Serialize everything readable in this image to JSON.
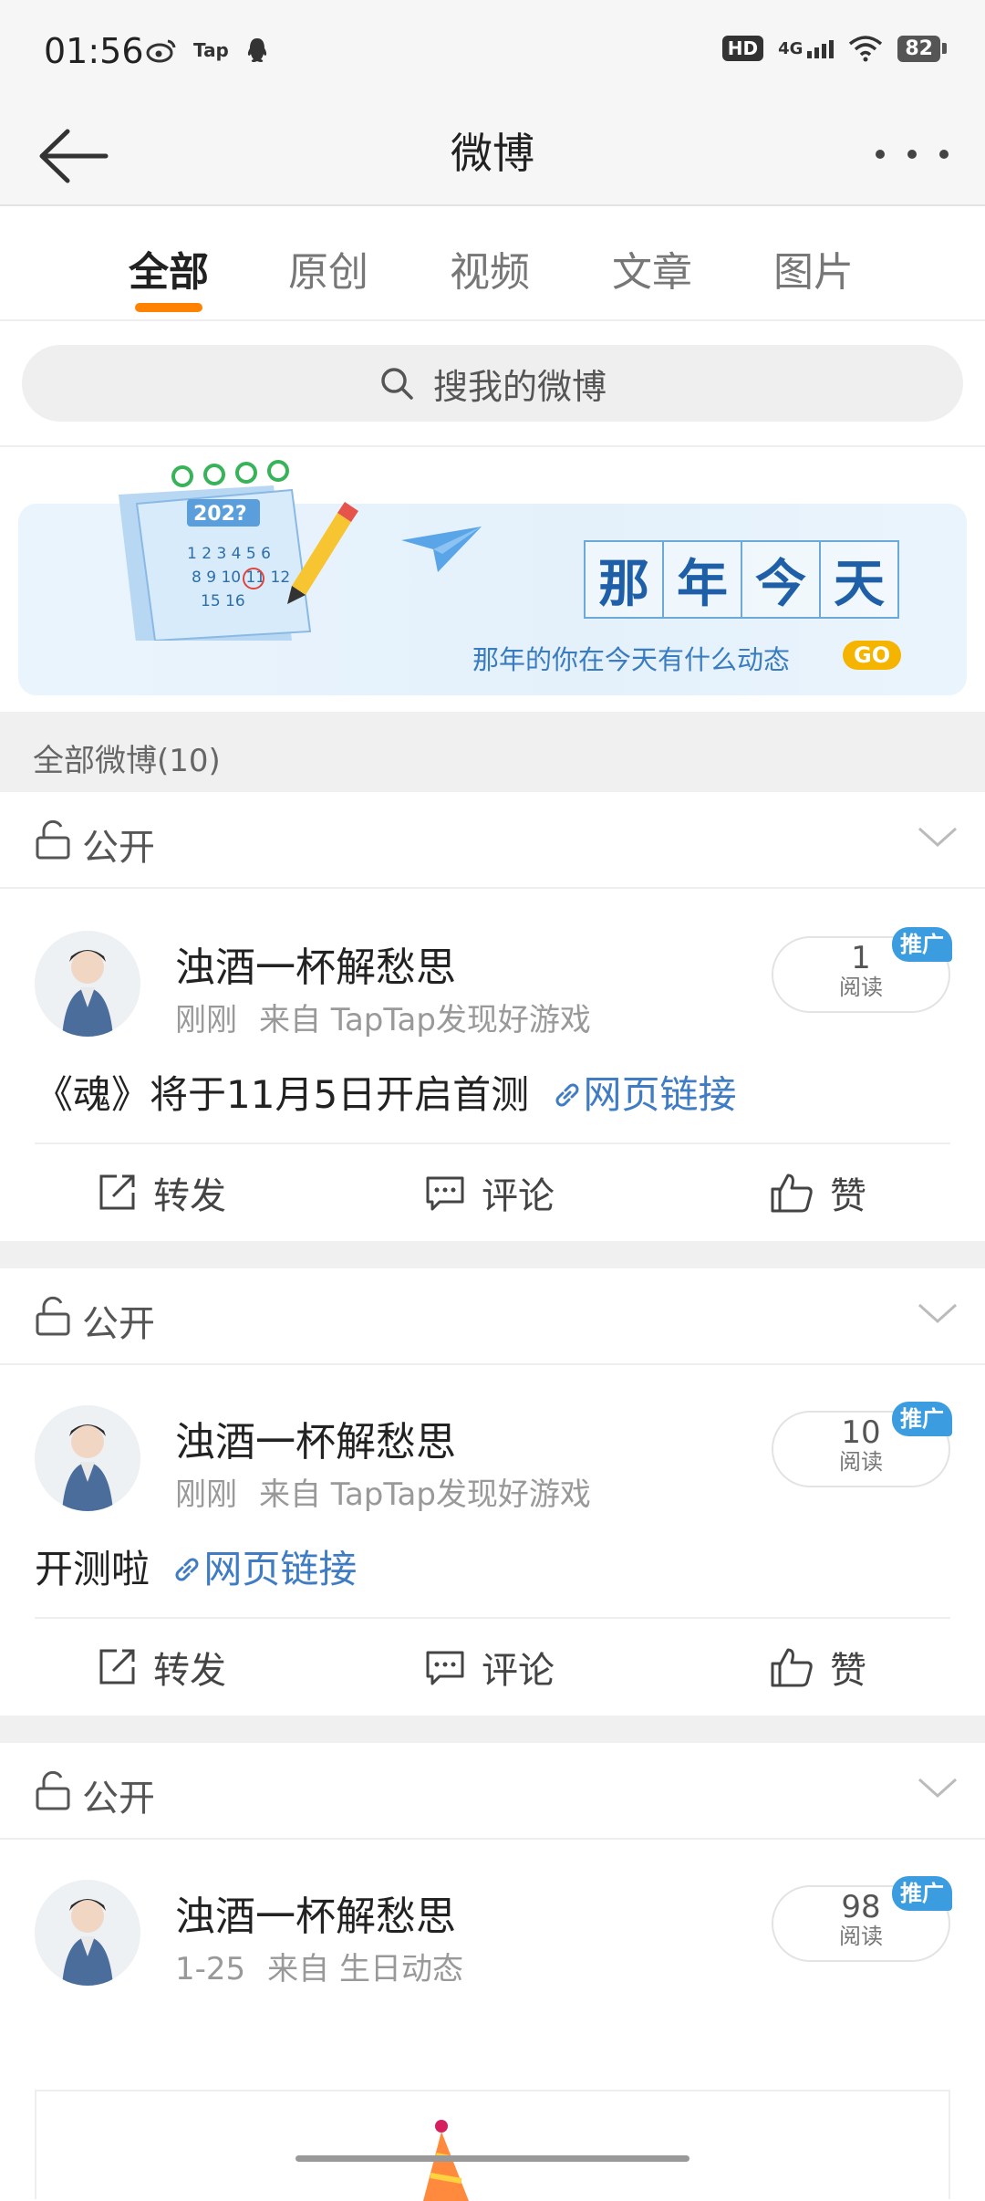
{
  "status_bar": {
    "time": "01:56",
    "app_icons": [
      "weibo-icon",
      "taptap-icon",
      "qq-icon"
    ],
    "hd": "HD",
    "network": "4G",
    "battery": "82"
  },
  "nav": {
    "title": "微博"
  },
  "tabs": [
    {
      "label": "全部",
      "active": true
    },
    {
      "label": "原创",
      "active": false
    },
    {
      "label": "视频",
      "active": false
    },
    {
      "label": "文章",
      "active": false
    },
    {
      "label": "图片",
      "active": false
    }
  ],
  "search": {
    "placeholder": "搜我的微博"
  },
  "banner": {
    "calendar_year": "202?",
    "title_chars": [
      "那",
      "年",
      "今",
      "天"
    ],
    "subtitle": "那年的你在今天有什么动态",
    "go_label": "GO"
  },
  "section": {
    "header": "全部微博(10)"
  },
  "posts": [
    {
      "privacy": "公开",
      "author": "浊酒一杯解愁思",
      "time": "刚刚",
      "source": "来自 TapTap发现好游戏",
      "reads_count": "1",
      "reads_label": "阅读",
      "promo_label": "推广",
      "text": "《魂》将于11月5日开启首测",
      "link_text": "网页链接",
      "actions": {
        "repost": "转发",
        "comment": "评论",
        "like": "赞"
      }
    },
    {
      "privacy": "公开",
      "author": "浊酒一杯解愁思",
      "time": "刚刚",
      "source": "来自 TapTap发现好游戏",
      "reads_count": "10",
      "reads_label": "阅读",
      "promo_label": "推广",
      "text": "开测啦",
      "link_text": "网页链接",
      "actions": {
        "repost": "转发",
        "comment": "评论",
        "like": "赞"
      }
    },
    {
      "privacy": "公开",
      "author": "浊酒一杯解愁思",
      "time": "1-25",
      "source": "来自 生日动态",
      "reads_count": "98",
      "reads_label": "阅读",
      "promo_label": "推广"
    }
  ],
  "colors": {
    "accent": "#ff8200",
    "link": "#3f7cc4",
    "promo": "#3b9de0",
    "go": "#f5b400"
  }
}
